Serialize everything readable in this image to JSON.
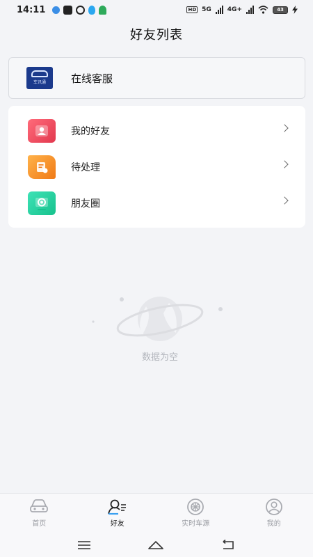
{
  "status_bar": {
    "time": "14:11",
    "network_5g": "5G",
    "network_4g": "4G+",
    "battery": "43"
  },
  "header": {
    "title": "好友列表"
  },
  "service": {
    "label": "在线客服",
    "logo_text": "车讯通"
  },
  "menu": {
    "items": [
      {
        "label": "我的好友",
        "icon": "contact-card-icon"
      },
      {
        "label": "待处理",
        "icon": "scroll-edit-icon"
      },
      {
        "label": "朋友圈",
        "icon": "moments-icon"
      }
    ]
  },
  "empty_state": {
    "text": "数据为空"
  },
  "tab_bar": {
    "tabs": [
      {
        "label": "首页",
        "icon": "car-icon",
        "active": false
      },
      {
        "label": "好友",
        "icon": "friends-icon",
        "active": true
      },
      {
        "label": "实时车源",
        "icon": "wheel-icon",
        "active": false
      },
      {
        "label": "我的",
        "icon": "user-icon",
        "active": false
      }
    ]
  },
  "colors": {
    "background": "#f3f4f7",
    "friends_icon": "#e2384e",
    "pending_icon": "#f07a16",
    "moments_icon": "#17c28d",
    "service_logo": "#1b3a8c"
  }
}
